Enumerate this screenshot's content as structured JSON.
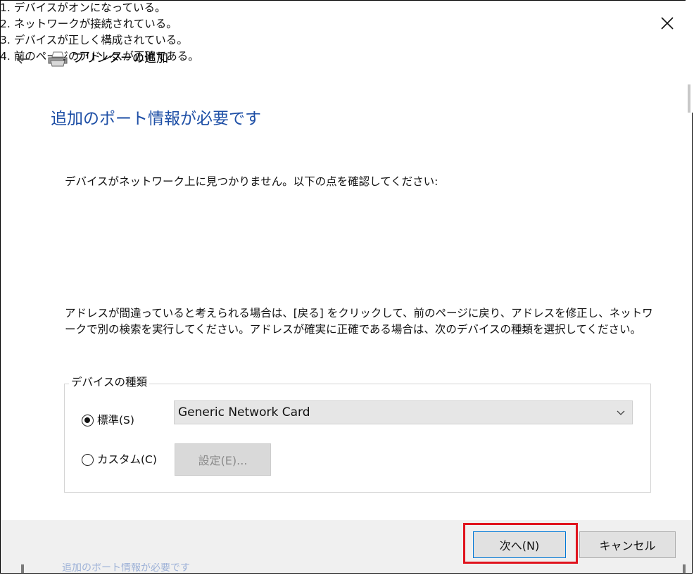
{
  "window": {
    "title": "プリンターの追加"
  },
  "heading": "追加のポート情報が必要です",
  "intro": "デバイスがネットワーク上に見つかりません。以下の点を確認してください:",
  "checklist": [
    "1.  デバイスがオンになっている。",
    "2.  ネットワークが接続されている。",
    "3.  デバイスが正しく構成されている。",
    "4. 前のページのアドレスが正確である。"
  ],
  "paragraph": "アドレスが間違っていると考えられる場合は、[戻る] をクリックして、前のページに戻り、アドレスを修正し、ネットワークで別の検索を実行してください。アドレスが確実に正確である場合は、次のデバイスの種類を選択してください。",
  "device_type": {
    "legend": "デバイスの種類",
    "standard_label": "標準(S)",
    "standard_checked": true,
    "custom_label": "カスタム(C)",
    "custom_checked": false,
    "select_value": "Generic Network Card",
    "settings_label": "設定(E)..."
  },
  "footer": {
    "next_label": "次へ(N)",
    "cancel_label": "キャンセル"
  },
  "background_text": "追加のポート情報が必要です",
  "colors": {
    "heading": "#1e4fa6",
    "highlight": "#e0141e",
    "focus_border": "#0078d7",
    "footer_bg": "#f0f0f0"
  },
  "icons": {
    "close": "close-icon",
    "back": "back-arrow-icon",
    "printer": "printer-icon",
    "dropdown": "chevron-down-icon"
  }
}
